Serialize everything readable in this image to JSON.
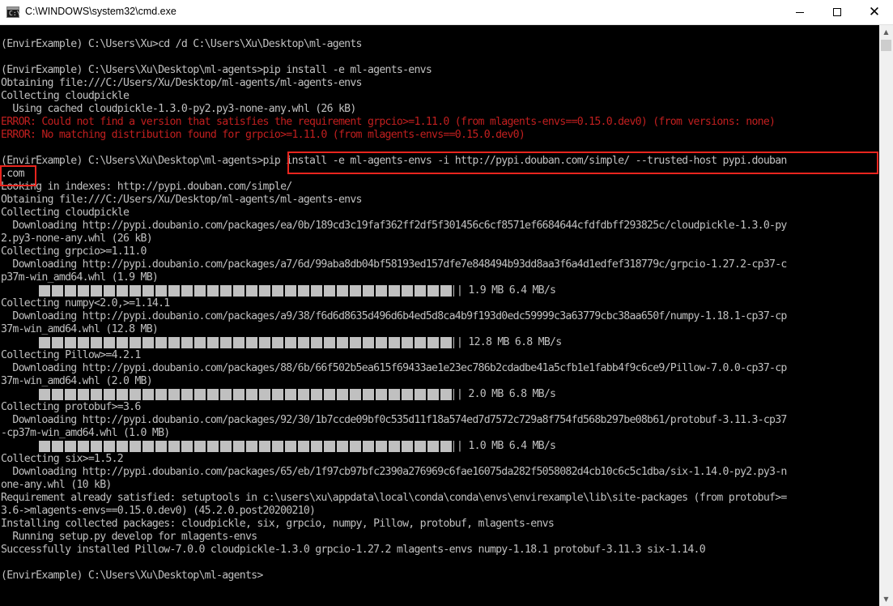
{
  "window": {
    "title": "C:\\WINDOWS\\system32\\cmd.exe",
    "icon_text": "C:\\"
  },
  "console": {
    "lines": [
      "(EnvirExample) C:\\Users\\Xu>cd /d C:\\Users\\Xu\\Desktop\\ml-agents",
      "",
      "(EnvirExample) C:\\Users\\Xu\\Desktop\\ml-agents>pip install -e ml-agents-envs",
      "Obtaining file:///C:/Users/Xu/Desktop/ml-agents/ml-agents-envs",
      "Collecting cloudpickle",
      "  Using cached cloudpickle-1.3.0-py2.py3-none-any.whl (26 kB)",
      "ERROR: Could not find a version that satisfies the requirement grpcio>=1.11.0 (from mlagents-envs==0.15.0.dev0) (from versions: none)",
      "ERROR: No matching distribution found for grpcio>=1.11.0 (from mlagents-envs==0.15.0.dev0)",
      "",
      "(EnvirExample) C:\\Users\\Xu\\Desktop\\ml-agents>pip install -e ml-agents-envs -i http://pypi.douban.com/simple/ --trusted-host pypi.douban",
      ".com",
      "Looking in indexes: http://pypi.douban.com/simple/",
      "Obtaining file:///C:/Users/Xu/Desktop/ml-agents/ml-agents-envs",
      "Collecting cloudpickle",
      "  Downloading http://pypi.doubanio.com/packages/ea/0b/189cd3c19faf362ff2df5f301456c6cf8571ef6684644cfdfdbff293825c/cloudpickle-1.3.0-py",
      "2.py3-none-any.whl (26 kB)",
      "Collecting grpcio>=1.11.0",
      "  Downloading http://pypi.doubanio.com/packages/a7/6d/99aba8db04bf58193ed157dfe7e848494b93dd8aa3f6a4d1edfef318779c/grpcio-1.27.2-cp37-c",
      "p37m-win_amd64.whl (1.9 MB)",
      "",
      "Collecting numpy<2.0,>=1.14.1",
      "  Downloading http://pypi.doubanio.com/packages/a9/38/f6d6d8635d496d6b4ed5d8ca4b9f193d0edc59999c3a63779cbc38aa650f/numpy-1.18.1-cp37-cp",
      "37m-win_amd64.whl (12.8 MB)",
      "",
      "Collecting Pillow>=4.2.1",
      "  Downloading http://pypi.doubanio.com/packages/88/6b/66f502b5ea615f69433ae1e23ec786b2cdadbe41a5cfb1e1fabb4f9c6ce9/Pillow-7.0.0-cp37-cp",
      "37m-win_amd64.whl (2.0 MB)",
      "",
      "Collecting protobuf>=3.6",
      "  Downloading http://pypi.doubanio.com/packages/92/30/1b7ccde09bf0c535d11f18a574ed7d7572c729a8f754fd568b297be08b61/protobuf-3.11.3-cp37",
      "-cp37m-win_amd64.whl (1.0 MB)",
      "",
      "Collecting six>=1.5.2",
      "  Downloading http://pypi.doubanio.com/packages/65/eb/1f97cb97bfc2390a276969c6fae16075da282f5058082d4cb10c6c5c1dba/six-1.14.0-py2.py3-n",
      "one-any.whl (10 kB)",
      "Requirement already satisfied: setuptools in c:\\users\\xu\\appdata\\local\\conda\\conda\\envs\\envirexample\\lib\\site-packages (from protobuf>=",
      "3.6->mlagents-envs==0.15.0.dev0) (45.2.0.post20200210)",
      "Installing collected packages: cloudpickle, six, grpcio, numpy, Pillow, protobuf, mlagents-envs",
      "  Running setup.py develop for mlagents-envs",
      "Successfully installed Pillow-7.0.0 cloudpickle-1.3.0 grpcio-1.27.2 mlagents-envs numpy-1.18.1 protobuf-3.11.3 six-1.14.0",
      "",
      "(EnvirExample) C:\\Users\\Xu\\Desktop\\ml-agents>"
    ],
    "progress_bars": [
      {
        "after_line": 18,
        "text": "| 1.9 MB 6.4 MB/s",
        "fraction": 1.0
      },
      {
        "after_line": 22,
        "text": "| 12.8 MB 6.8 MB/s",
        "fraction": 1.0
      },
      {
        "after_line": 26,
        "text": "| 2.0 MB 6.8 MB/s",
        "fraction": 1.0
      },
      {
        "after_line": 30,
        "text": "| 1.0 MB 6.4 MB/s",
        "fraction": 1.0
      }
    ]
  },
  "colors": {
    "console_bg": "#000000",
    "console_text": "#c0c0c0",
    "error_text": "#c21f1f",
    "highlight_box": "#e8251e"
  }
}
